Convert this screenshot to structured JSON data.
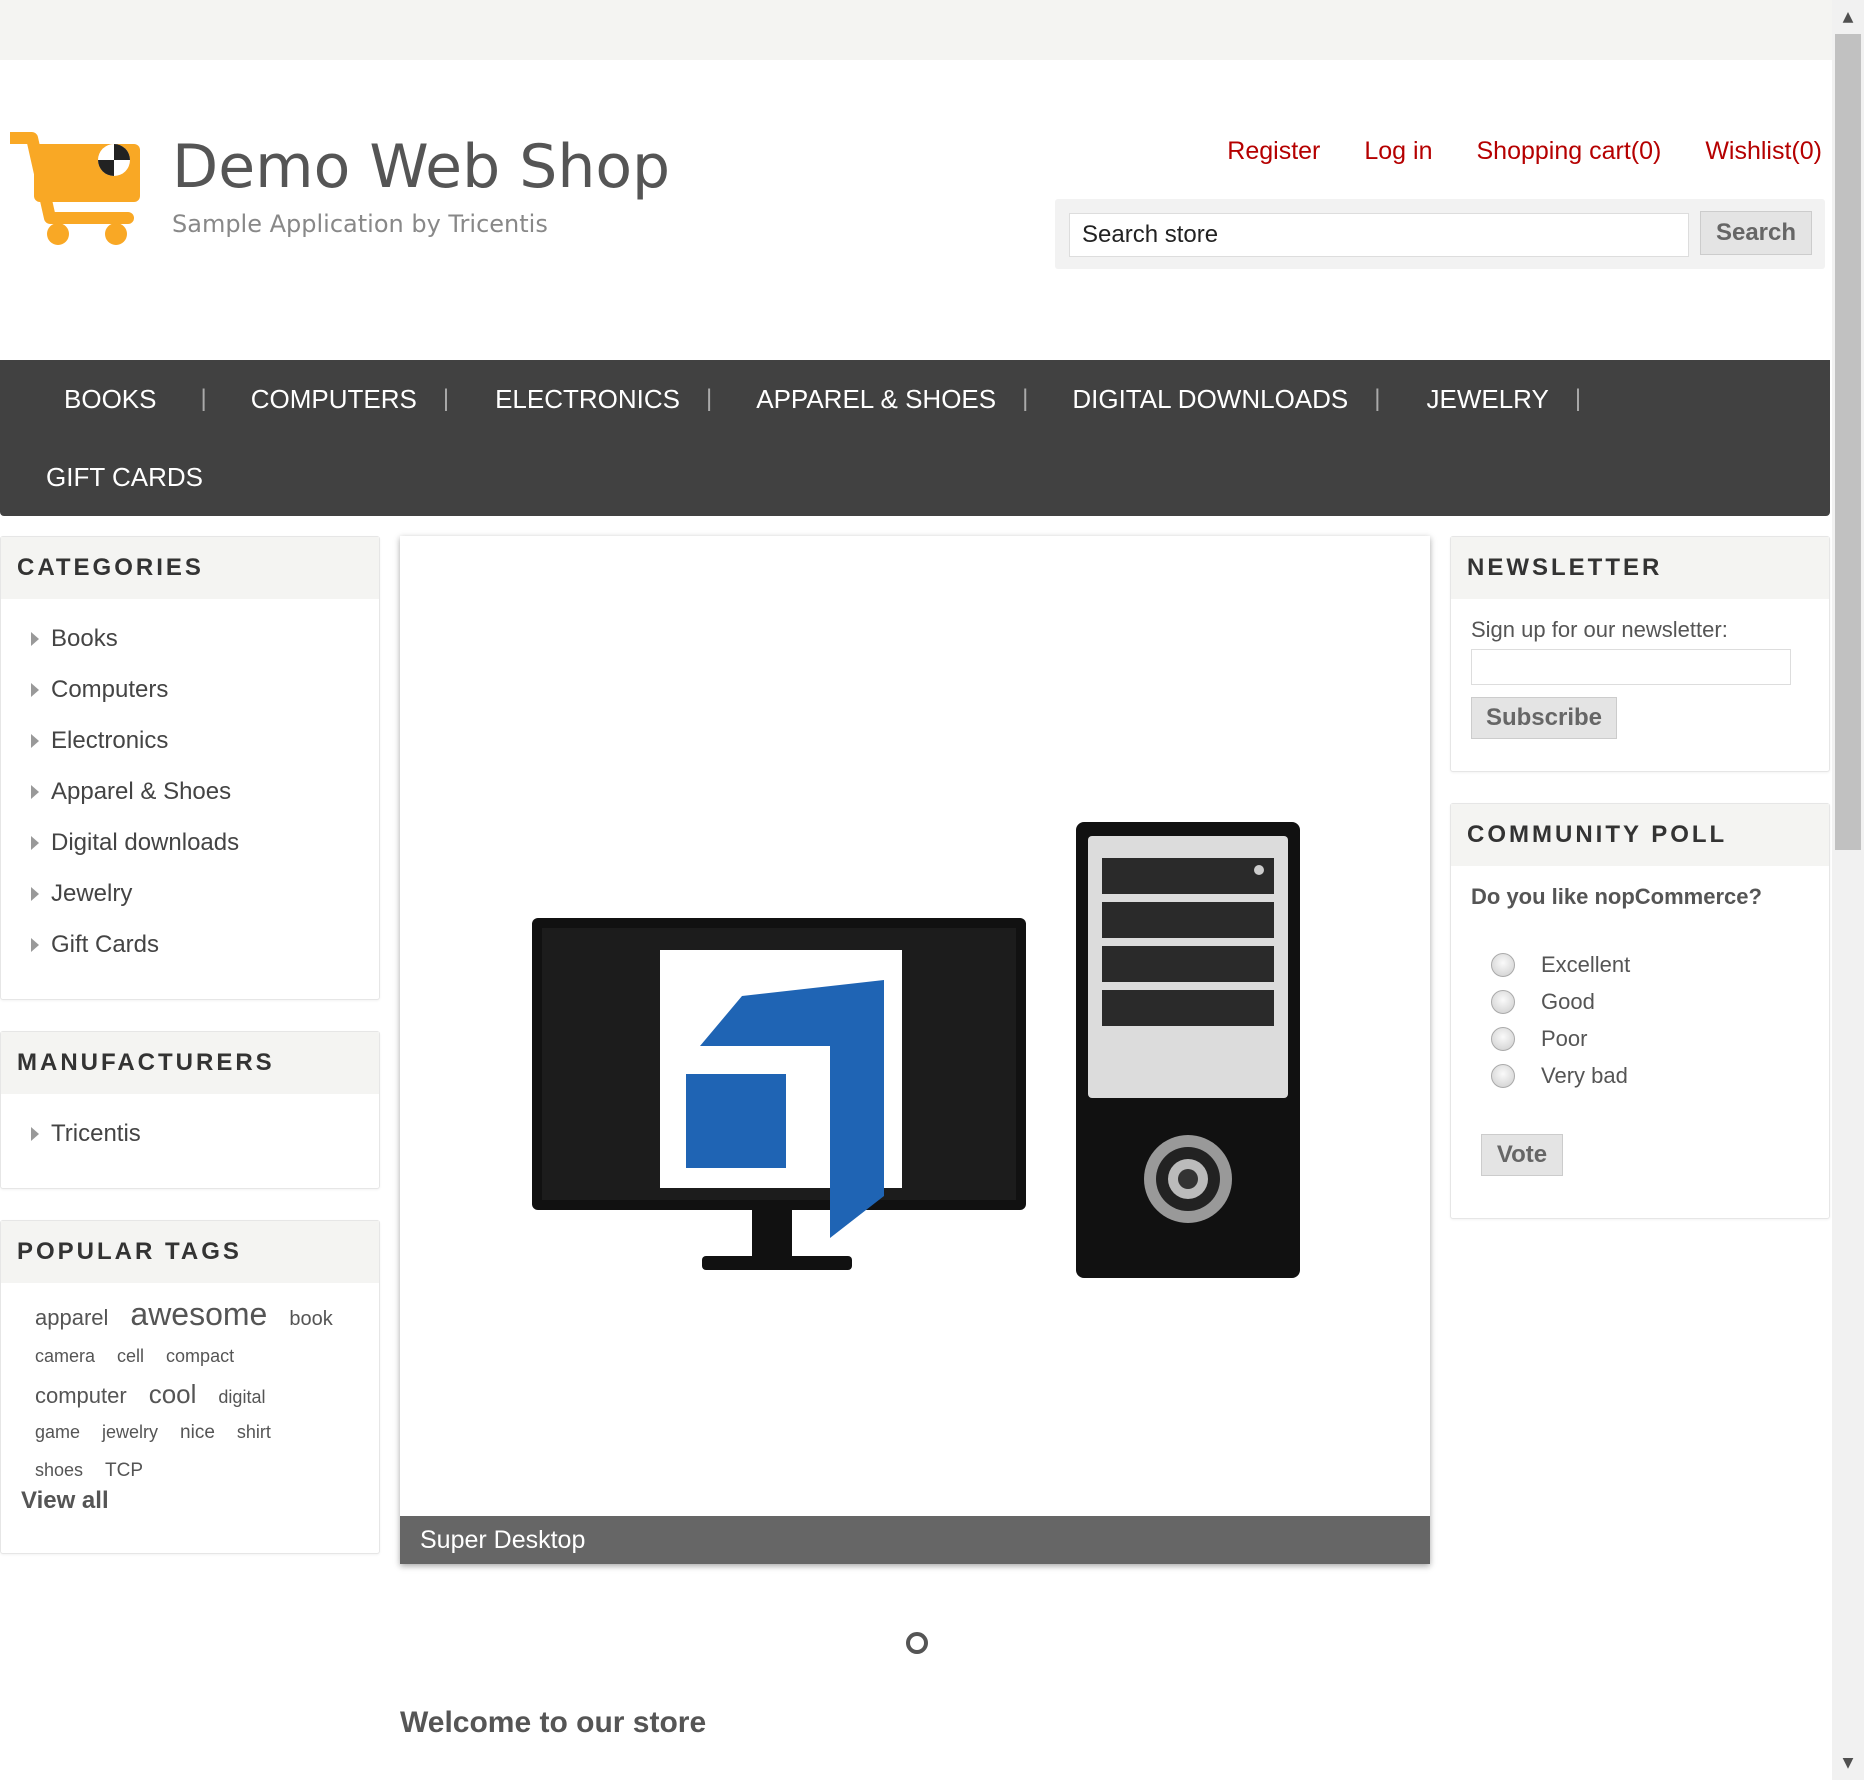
{
  "header": {
    "logo_title": "Demo Web Shop",
    "logo_subtitle": "Sample Application by Tricentis",
    "links": [
      "Register",
      "Log in",
      "Shopping cart(0)",
      "Wishlist(0)"
    ],
    "search": {
      "value": "Search store",
      "button": "Search"
    }
  },
  "topmenu": {
    "row1": [
      "BOOKS",
      "COMPUTERS",
      "ELECTRONICS",
      "APPAREL & SHOES",
      "DIGITAL DOWNLOADS",
      "JEWELRY"
    ],
    "row2": [
      "GIFT CARDS"
    ]
  },
  "categories": {
    "title": "CATEGORIES",
    "items": [
      "Books",
      "Computers",
      "Electronics",
      "Apparel & Shoes",
      "Digital downloads",
      "Jewelry",
      "Gift Cards"
    ]
  },
  "manufacturers": {
    "title": "MANUFACTURERS",
    "items": [
      "Tricentis"
    ]
  },
  "tags": {
    "title": "POPULAR TAGS",
    "items": [
      {
        "label": "apparel",
        "size": 22
      },
      {
        "label": "awesome",
        "size": 32
      },
      {
        "label": "book",
        "size": 20
      },
      {
        "label": "camera",
        "size": 18
      },
      {
        "label": "cell",
        "size": 18
      },
      {
        "label": "compact",
        "size": 18
      },
      {
        "label": "computer",
        "size": 22
      },
      {
        "label": "cool",
        "size": 26
      },
      {
        "label": "digital",
        "size": 18
      },
      {
        "label": "game",
        "size": 18
      },
      {
        "label": "jewelry",
        "size": 18
      },
      {
        "label": "nice",
        "size": 19
      },
      {
        "label": "shirt",
        "size": 18
      },
      {
        "label": "shoes",
        "size": 18
      },
      {
        "label": "TCP",
        "size": 19
      }
    ],
    "view_all": "View all"
  },
  "slider": {
    "caption": "Super Desktop"
  },
  "welcome": "Welcome to our store",
  "newsletter": {
    "title": "NEWSLETTER",
    "label": "Sign up for our newsletter:",
    "button": "Subscribe"
  },
  "poll": {
    "title": "COMMUNITY POLL",
    "question": "Do you like nopCommerce?",
    "options": [
      "Excellent",
      "Good",
      "Poor",
      "Very bad"
    ],
    "button": "Vote"
  },
  "colors": {
    "link_red": "#b50000",
    "menu_bg": "#414141",
    "accent_blue": "#1f64b4",
    "cart_orange": "#f9a825"
  }
}
